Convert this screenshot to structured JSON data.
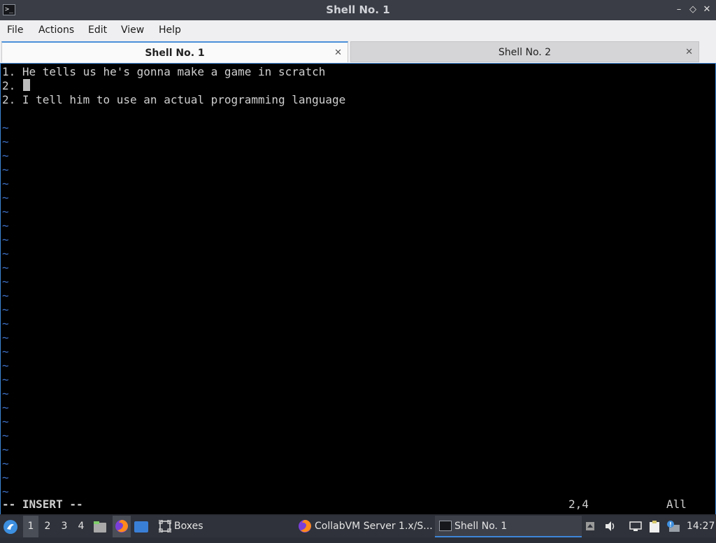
{
  "window": {
    "title": "Shell No. 1",
    "app_icon_glyph": ">_",
    "minimize_glyph": "–",
    "restore_glyph": "◇",
    "close_glyph": "✕"
  },
  "menu": [
    "File",
    "Actions",
    "Edit",
    "View",
    "Help"
  ],
  "tabs": [
    {
      "label": "Shell No. 1",
      "close": "✕"
    },
    {
      "label": "Shell No. 2",
      "close": "✕"
    }
  ],
  "terminal": {
    "lines": [
      "1. He tells us he's gonna make a game in scratch",
      "2. ",
      "2. I tell him to use an actual programming language"
    ],
    "tilde_char": "~",
    "mode": "-- INSERT --",
    "position": "2,4",
    "scroll": "All"
  },
  "taskbar": {
    "workspaces": [
      "1",
      "2",
      "3",
      "4"
    ],
    "tasks": {
      "boxes": "Boxes",
      "collabvm": "CollabVM Server 1.x/S...",
      "shell": "Shell No. 1"
    },
    "clock": "14:27"
  },
  "colors": {
    "accent": "#3e86d8",
    "terminal_bg": "#000000",
    "tilde": "#3d6fc4"
  }
}
